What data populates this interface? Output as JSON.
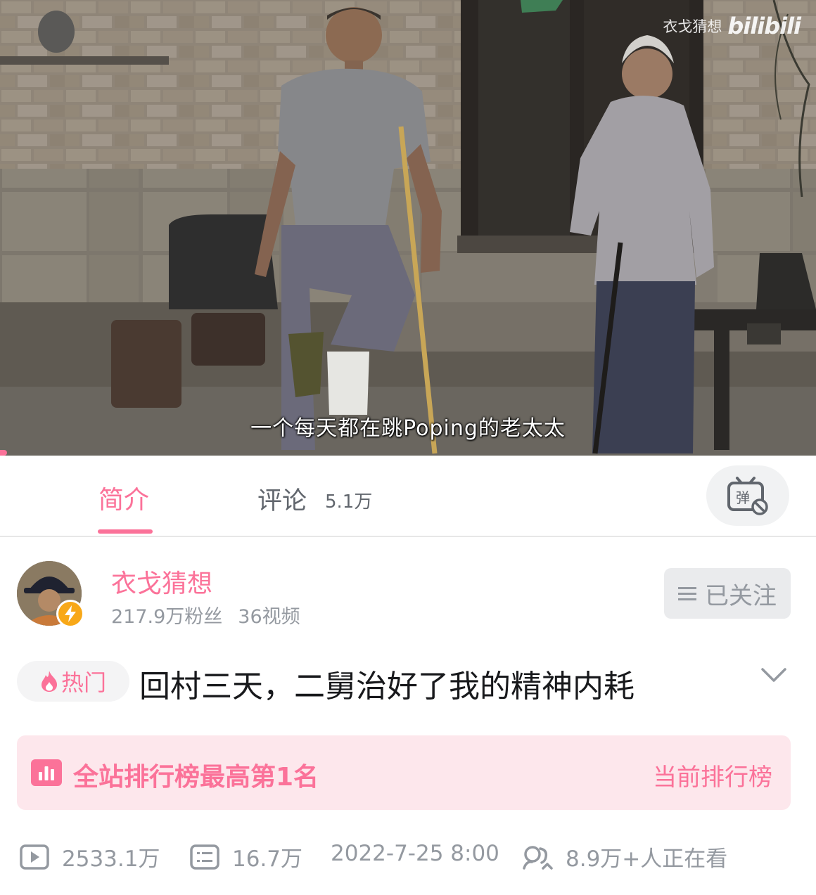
{
  "video": {
    "watermark_author": "衣戈猜想",
    "watermark_logo": "bilibili",
    "subtitle": "一个每天都在跳Poping的老太太"
  },
  "tabs": {
    "intro_label": "简介",
    "comment_label": "评论",
    "comment_count": "5.1万",
    "danmaku_icon": "danmaku-icon"
  },
  "uploader": {
    "name": "衣戈猜想",
    "fans": "217.9万粉丝",
    "videos": "36视频",
    "follow_label": "已关注"
  },
  "title": {
    "tag": "热门",
    "text": "回村三天，二舅治好了我的精神内耗"
  },
  "ranking": {
    "text": "全站排行榜最高第1名",
    "link": "当前排行榜"
  },
  "stats": {
    "plays": "2533.1万",
    "danmaku": "16.7万",
    "date": "2022-7-25 8:00",
    "watching": "8.9万+人正在看"
  },
  "colors": {
    "accent": "#fb7299",
    "muted": "#9499a0",
    "rank_bg": "#fde7ec"
  }
}
